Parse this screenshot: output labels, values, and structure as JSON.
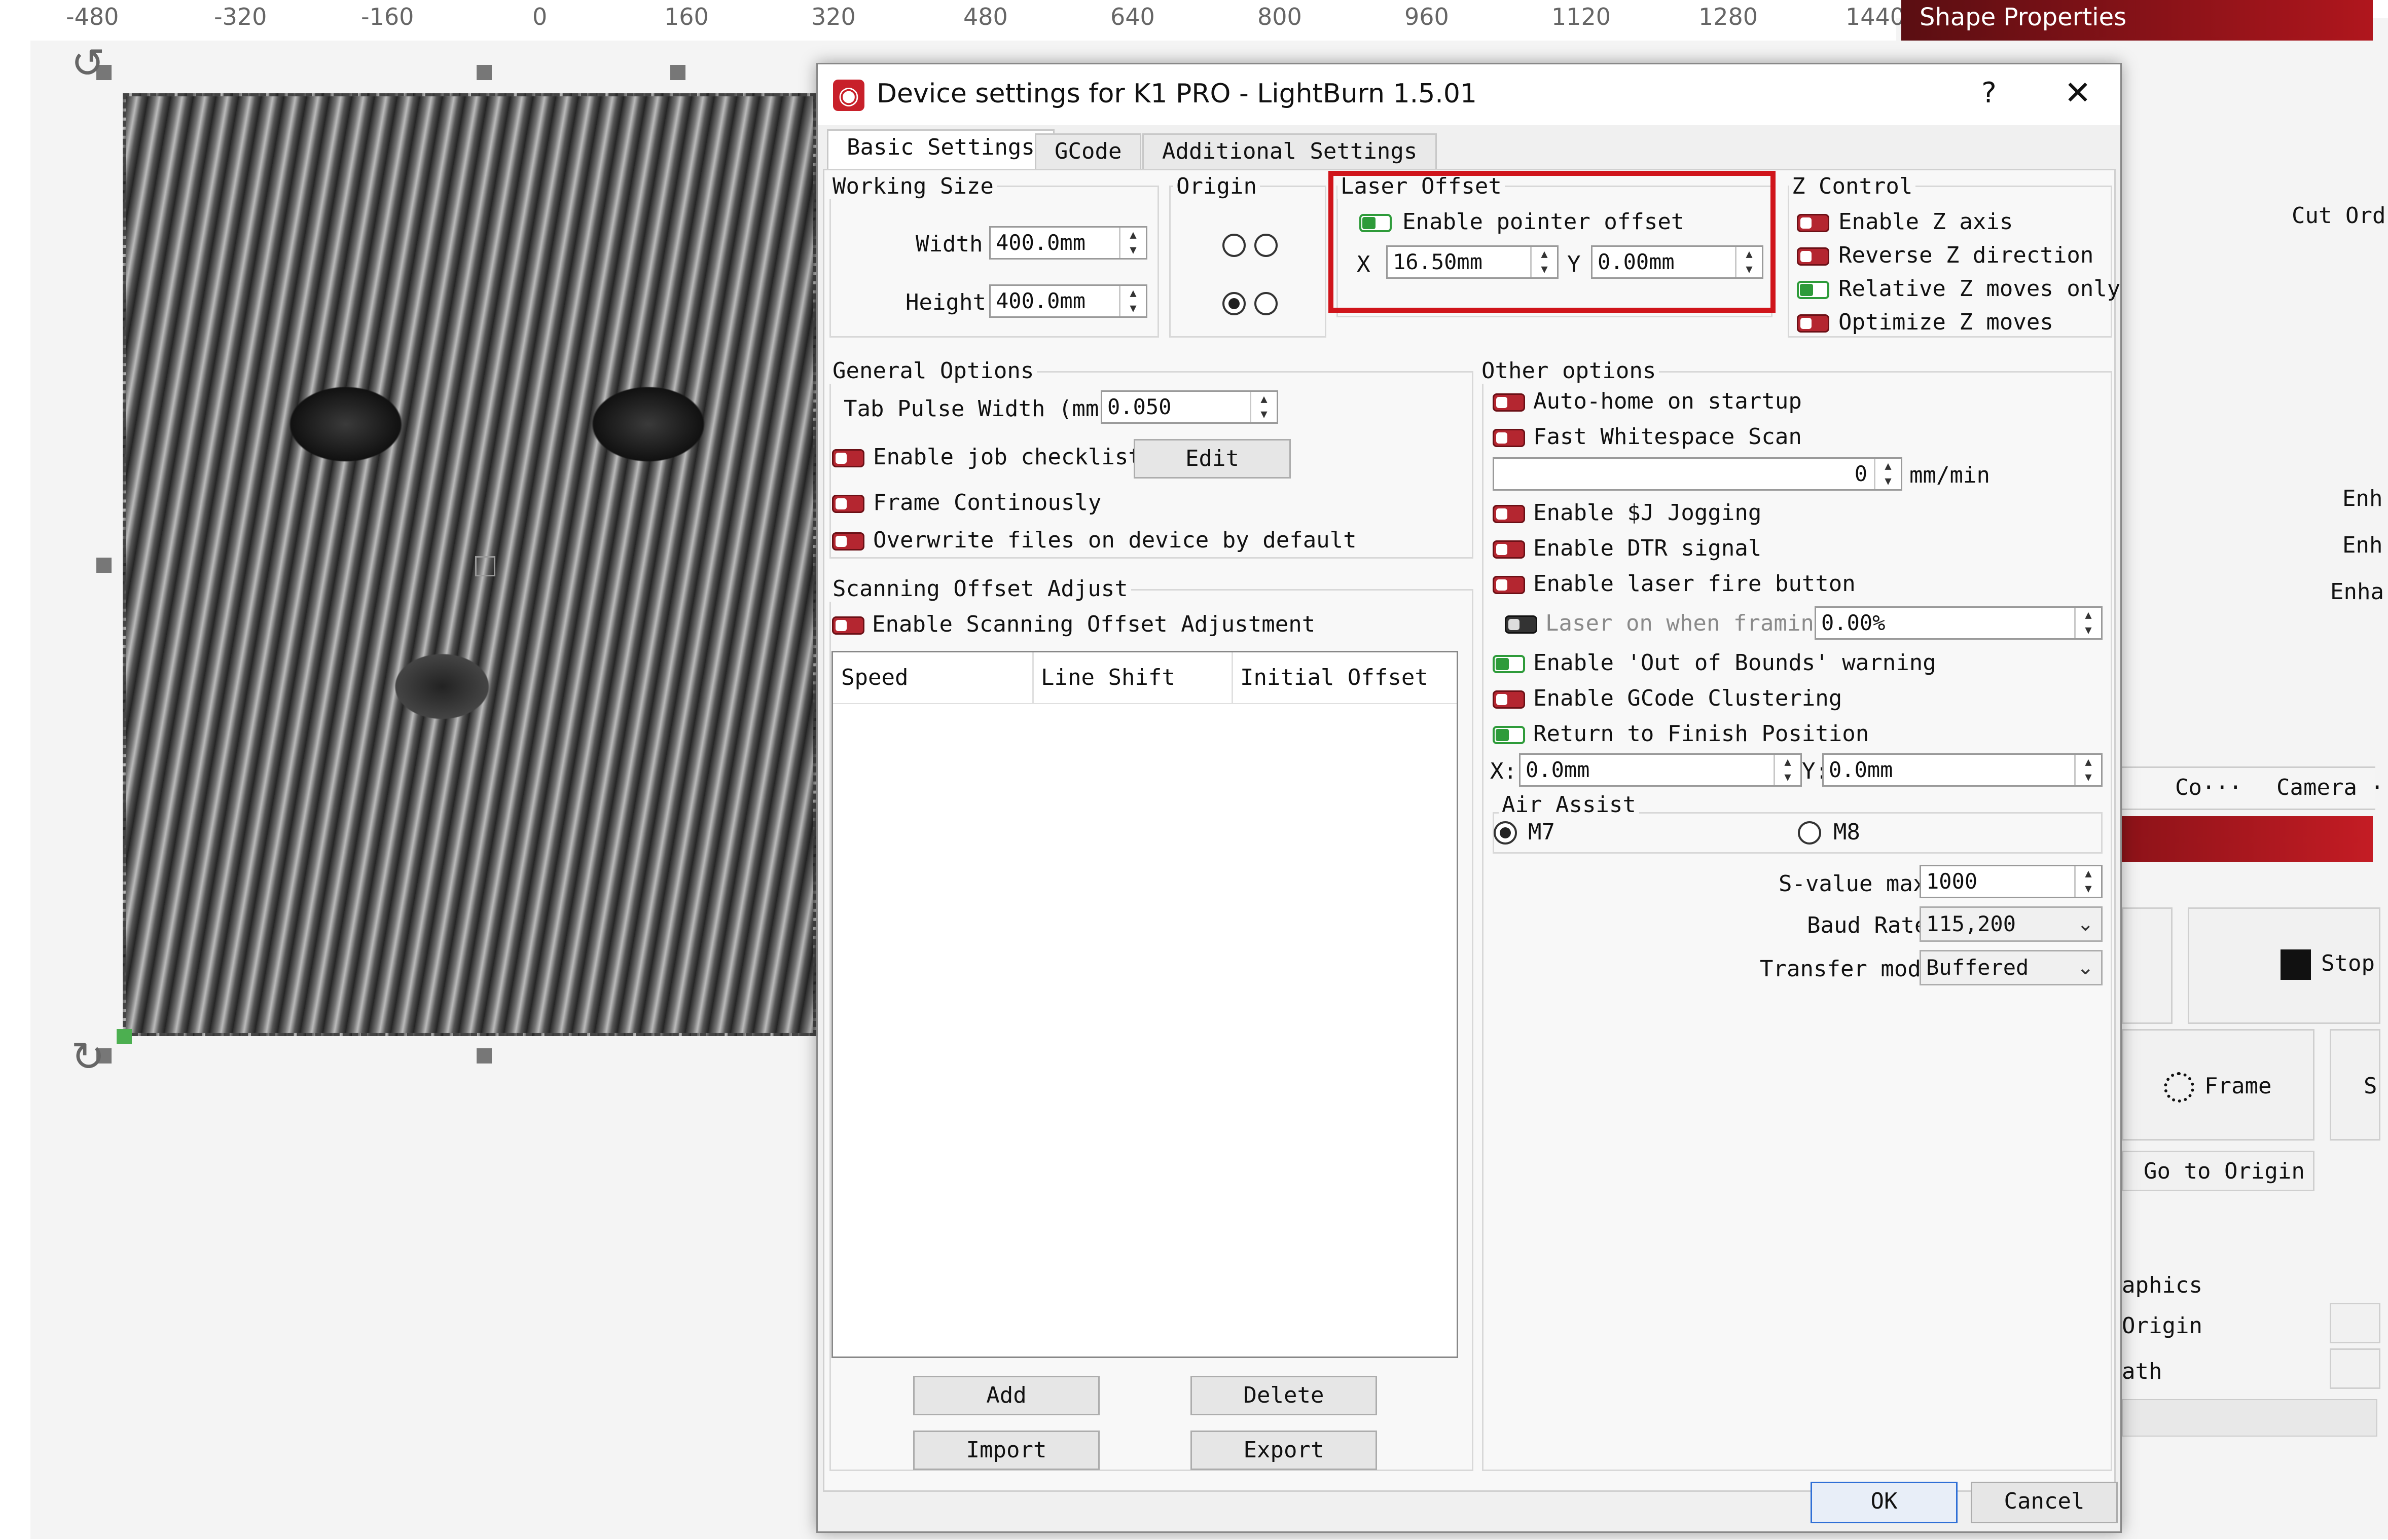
{
  "ruler": {
    "ticks": [
      "-480",
      "-320",
      "-160",
      "0",
      "160",
      "320",
      "480",
      "640",
      "800",
      "960",
      "1120",
      "1280",
      "1440"
    ]
  },
  "right_panel": {
    "header_title": "Shape Properties",
    "cut_order": "Cut Ord",
    "en1": "Enh",
    "en2": "Enh",
    "en3": "Enha",
    "tab_co": "Co···",
    "tab_camera": "Camera ··",
    "stop_label": "Stop",
    "frame_label": "Frame",
    "s_label": "S",
    "go_to_origin": "Go to Origin",
    "graphics": "aphics",
    "origin": "Origin",
    "path": "ath"
  },
  "dialog": {
    "title": "Device settings for K1 PRO - LightBurn 1.5.01",
    "help": "?",
    "close": "✕",
    "tabs": [
      "Basic Settings",
      "GCode",
      "Additional Settings"
    ],
    "working_size": {
      "title": "Working Size",
      "width_label": "Width",
      "width_value": "400.0mm",
      "height_label": "Height",
      "height_value": "400.0mm"
    },
    "origin": {
      "title": "Origin",
      "selected": "bottom-left"
    },
    "laser_offset": {
      "title": "Laser Offset",
      "enable_label": "Enable pointer offset",
      "enabled": true,
      "x_label": "X",
      "x_value": "16.50mm",
      "y_label": "Y",
      "y_value": "0.00mm"
    },
    "z_control": {
      "title": "Z Control",
      "items": [
        {
          "label": "Enable Z axis",
          "on": false
        },
        {
          "label": "Reverse Z direction",
          "on": false
        },
        {
          "label": "Relative Z moves only",
          "on": true
        },
        {
          "label": "Optimize Z moves",
          "on": false
        }
      ]
    },
    "general_options": {
      "title": "General Options",
      "tab_pulse_label": "Tab Pulse Width (mm)",
      "tab_pulse_value": "0.050",
      "enable_job_checklist": "Enable job checklist",
      "edit_button": "Edit",
      "frame_continuously": "Frame Continously",
      "overwrite_files": "Overwrite files on device by default"
    },
    "scanning_offset": {
      "title": "Scanning Offset Adjust",
      "enable_label": "Enable Scanning Offset Adjustment",
      "columns": [
        "Speed",
        "Line Shift",
        "Initial Offset"
      ],
      "add": "Add",
      "delete": "Delete",
      "import": "Import",
      "export": "Export"
    },
    "other_options": {
      "title": "Other options",
      "auto_home": "Auto-home on startup",
      "fast_whitespace": "Fast Whitespace Scan",
      "whitespace_speed": "0",
      "whitespace_unit": "mm/min",
      "enable_sj": "Enable $J Jogging",
      "enable_dtr": "Enable DTR signal",
      "enable_fire": "Enable laser fire button",
      "laser_on_framing": "Laser on when framing",
      "laser_on_framing_value": "0.00%",
      "out_of_bounds": "Enable 'Out of Bounds' warning",
      "gcode_clustering": "Enable GCode Clustering",
      "return_finish": "Return to Finish Position",
      "x_label": "X:",
      "x_value": "0.0mm",
      "y_label": "Y:",
      "y_value": "0.0mm",
      "air_assist_title": "Air Assist",
      "m7": "M7",
      "m8": "M8",
      "svalue_label": "S-value max",
      "svalue": "1000",
      "baud_label": "Baud Rate",
      "baud_value": "115,200",
      "transfer_label": "Transfer mode",
      "transfer_value": "Buffered"
    },
    "ok": "OK",
    "cancel": "Cancel"
  }
}
